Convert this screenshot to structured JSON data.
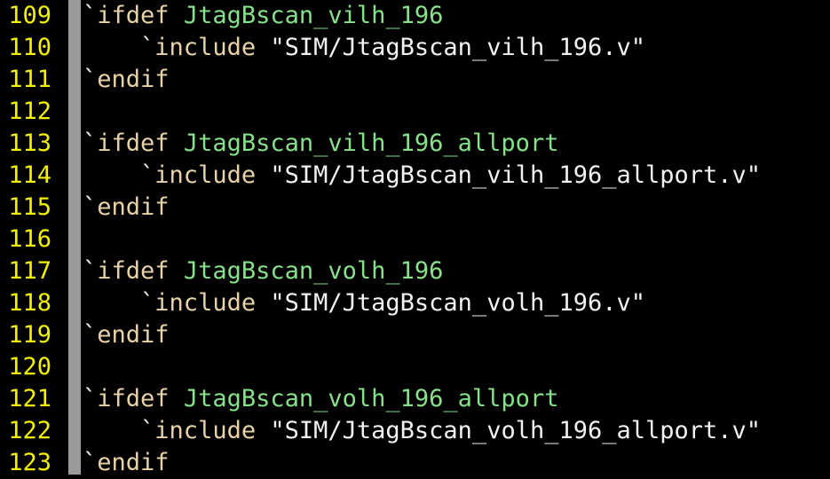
{
  "editor": {
    "lines": [
      {
        "num": "109",
        "indent": "",
        "tick": "`",
        "keyword": "ifdef",
        "space": " ",
        "arg": "JtagBscan_vilh_196",
        "type": "ifdef"
      },
      {
        "num": "110",
        "indent": "    ",
        "tick": "`",
        "keyword": "include",
        "space": " ",
        "arg": "\"SIM/JtagBscan_vilh_196.v\"",
        "type": "include"
      },
      {
        "num": "111",
        "indent": "",
        "tick": "`",
        "keyword": "endif",
        "space": "",
        "arg": "",
        "type": "endif"
      },
      {
        "num": "112",
        "indent": "",
        "tick": "",
        "keyword": "",
        "space": "",
        "arg": "",
        "type": "blank"
      },
      {
        "num": "113",
        "indent": "",
        "tick": "`",
        "keyword": "ifdef",
        "space": " ",
        "arg": "JtagBscan_vilh_196_allport",
        "type": "ifdef"
      },
      {
        "num": "114",
        "indent": "    ",
        "tick": "`",
        "keyword": "include",
        "space": " ",
        "arg": "\"SIM/JtagBscan_vilh_196_allport.v\"",
        "type": "include"
      },
      {
        "num": "115",
        "indent": "",
        "tick": "`",
        "keyword": "endif",
        "space": "",
        "arg": "",
        "type": "endif"
      },
      {
        "num": "116",
        "indent": "",
        "tick": "",
        "keyword": "",
        "space": "",
        "arg": "",
        "type": "blank"
      },
      {
        "num": "117",
        "indent": "",
        "tick": "`",
        "keyword": "ifdef",
        "space": " ",
        "arg": "JtagBscan_volh_196",
        "type": "ifdef"
      },
      {
        "num": "118",
        "indent": "    ",
        "tick": "`",
        "keyword": "include",
        "space": " ",
        "arg": "\"SIM/JtagBscan_volh_196.v\"",
        "type": "include"
      },
      {
        "num": "119",
        "indent": "",
        "tick": "`",
        "keyword": "endif",
        "space": "",
        "arg": "",
        "type": "endif"
      },
      {
        "num": "120",
        "indent": "",
        "tick": "",
        "keyword": "",
        "space": "",
        "arg": "",
        "type": "blank"
      },
      {
        "num": "121",
        "indent": "",
        "tick": "`",
        "keyword": "ifdef",
        "space": " ",
        "arg": "JtagBscan_volh_196_allport",
        "type": "ifdef"
      },
      {
        "num": "122",
        "indent": "    ",
        "tick": "`",
        "keyword": "include",
        "space": " ",
        "arg": "\"SIM/JtagBscan_volh_196_allport.v\"",
        "type": "include"
      },
      {
        "num": "123",
        "indent": "",
        "tick": "`",
        "keyword": "endif",
        "space": "",
        "arg": "",
        "type": "endif"
      }
    ]
  },
  "colors": {
    "background": "#000000",
    "line_number": "#f2f200",
    "fold_column": "#9a9a9a",
    "identifier": "#87e08a",
    "keyword": "#e8d3a8",
    "string": "#f2f2f2"
  }
}
